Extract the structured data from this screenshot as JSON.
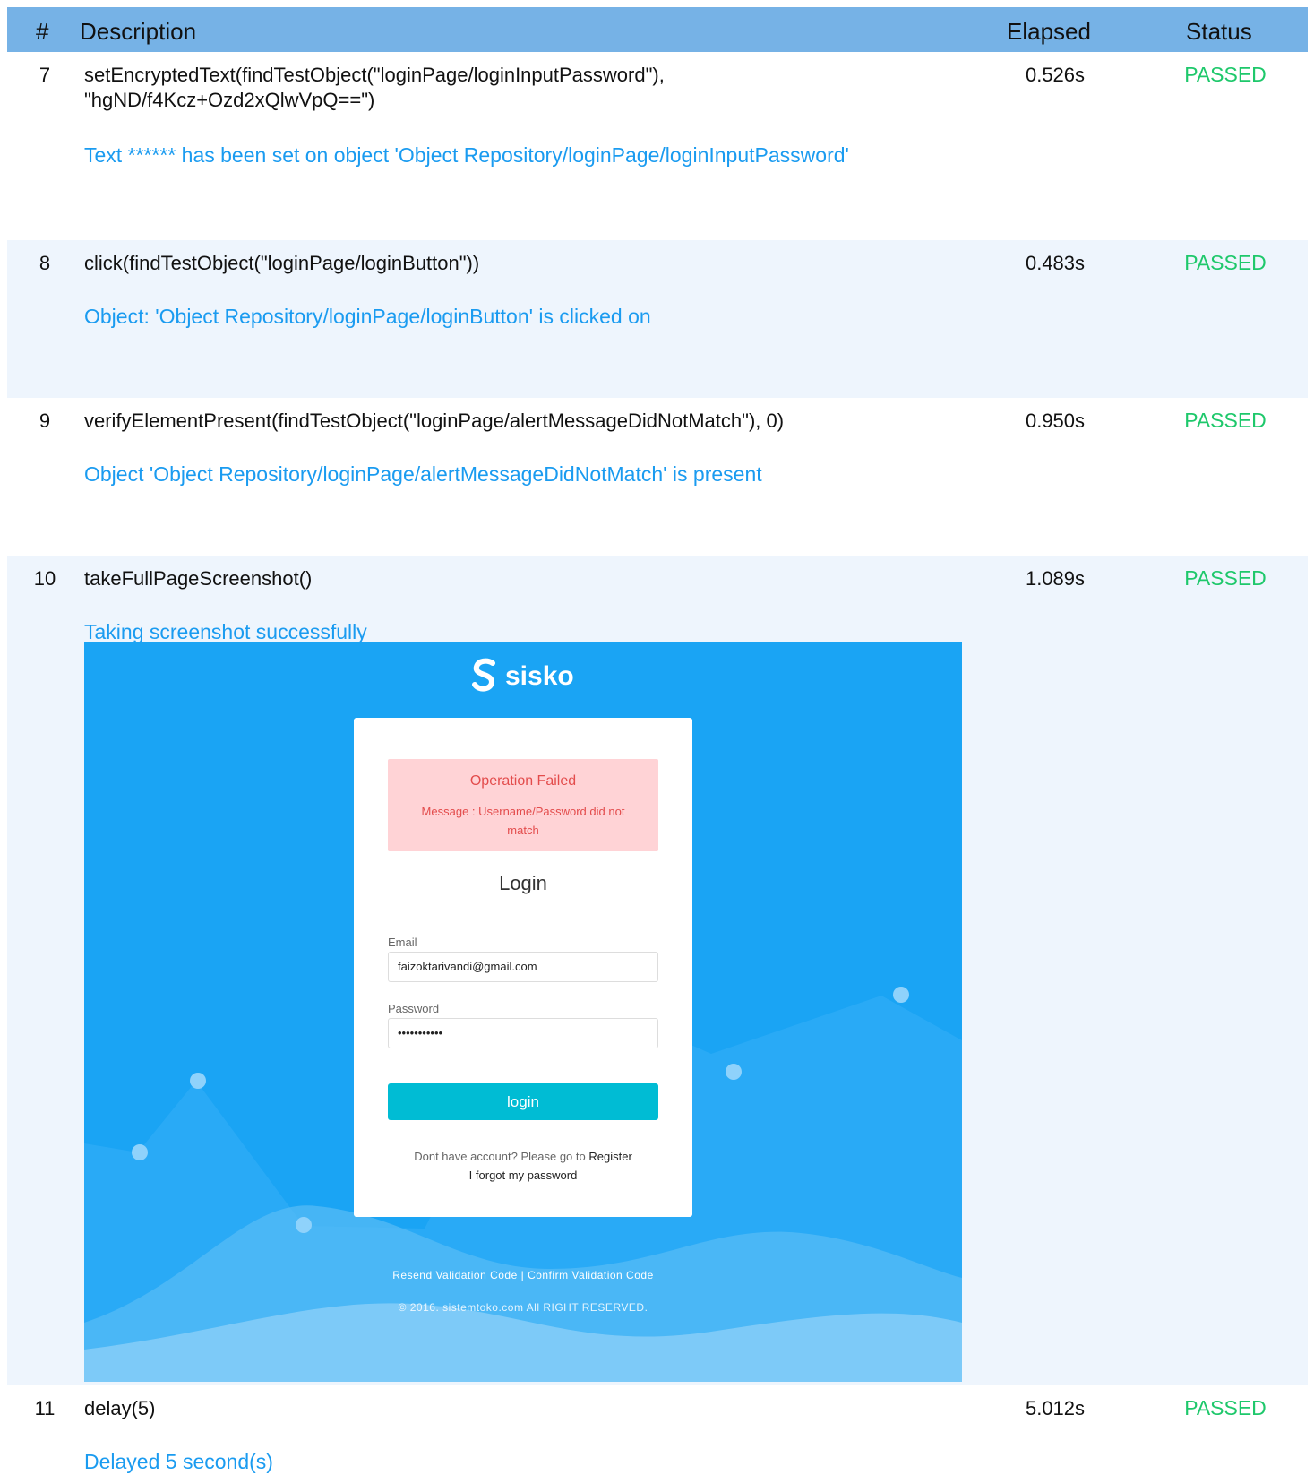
{
  "header": {
    "num": "#",
    "description": "Description",
    "elapsed": "Elapsed",
    "status": "Status"
  },
  "rows": [
    {
      "num": "7",
      "description_line1": "setEncryptedText(findTestObject(\"loginPage/loginInputPassword\"),",
      "description_line2": "\"hgND/f4Kcz+Ozd2xQlwVpQ==\")",
      "elapsed": "0.526s",
      "status": "PASSED",
      "message": "Text ****** has been set on object 'Object Repository/loginPage/loginInputPassword'"
    },
    {
      "num": "8",
      "description_line1": "click(findTestObject(\"loginPage/loginButton\"))",
      "elapsed": "0.483s",
      "status": "PASSED",
      "message": "Object: 'Object Repository/loginPage/loginButton' is clicked on"
    },
    {
      "num": "9",
      "description_line1": "verifyElementPresent(findTestObject(\"loginPage/alertMessageDidNotMatch\"), 0)",
      "elapsed": "0.950s",
      "status": "PASSED",
      "message": "Object 'Object Repository/loginPage/alertMessageDidNotMatch' is present"
    },
    {
      "num": "10",
      "description_line1": "takeFullPageScreenshot()",
      "elapsed": "1.089s",
      "status": "PASSED",
      "message": "Taking screenshot successfully"
    },
    {
      "num": "11",
      "description_line1": "delay(5)",
      "elapsed": "5.012s",
      "status": "PASSED",
      "message": "Delayed 5 second(s)"
    }
  ],
  "screenshot": {
    "brand": "sisko",
    "alert_title": "Operation Failed",
    "alert_message": "Message : Username/Password did not match",
    "login_title": "Login",
    "email_label": "Email",
    "email_value": "faizoktarivandi@gmail.com",
    "password_label": "Password",
    "password_value": "•••••••••••",
    "login_button": "login",
    "register_prefix": "Dont have account? Please go to ",
    "register_link": "Register",
    "forgot_link": "I forgot my password",
    "footer_links": "Resend Validation Code | Confirm Validation Code",
    "footer_copy": "© 2016. sistemtoko.com All RIGHT RESERVED."
  },
  "colors": {
    "header_bg": "#76b2e6",
    "row_alt_bg": "#eef5fd",
    "passed": "#1ec86b",
    "message": "#1a9bf0",
    "screenshot_bg": "#1aa4f4",
    "alert_bg": "#ffd3d6",
    "alert_text": "#e34c4c",
    "login_button": "#00bcd4"
  }
}
